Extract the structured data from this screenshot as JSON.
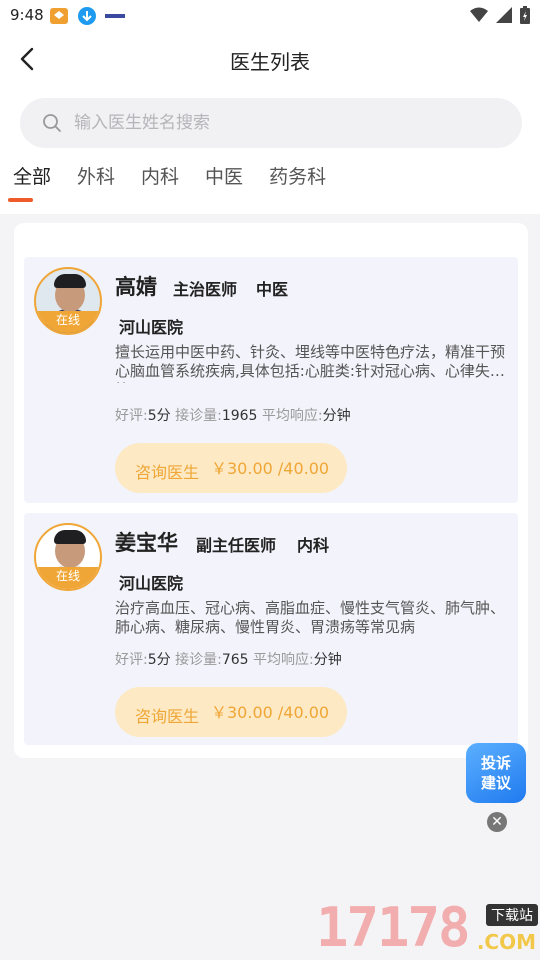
{
  "status_bar": {
    "time": "9:48"
  },
  "header": {
    "title": "医生列表"
  },
  "search": {
    "placeholder": "输入医生姓名搜索"
  },
  "tabs": [
    {
      "label": "全部",
      "active": true
    },
    {
      "label": "外科",
      "active": false
    },
    {
      "label": "内科",
      "active": false
    },
    {
      "label": "中医",
      "active": false
    },
    {
      "label": "药务科",
      "active": false
    }
  ],
  "doctors": [
    {
      "name": "高婧",
      "title": "主治医师",
      "dept": "中医",
      "hospital": "河山医院",
      "badge": "在线",
      "desc": "擅长运用中医中药、针灸、埋线等中医特色疗法，精准干预心脑血管系统疾病,具体包括:心脏类:针对冠心病、心律失常等",
      "rating_label": "好评:",
      "rating": "5分",
      "consult_label": "接诊量:",
      "consult_count": "1965",
      "resp_label": "平均响应:",
      "resp_unit": "分钟",
      "button_label": "咨询医生",
      "price": "￥30.00 /40.00"
    },
    {
      "name": "姜宝华",
      "title": "副主任医师",
      "dept": "内科",
      "hospital": "河山医院",
      "badge": "在线",
      "desc": "治疗高血压、冠心病、高脂血症、慢性支气管炎、肺气肿、肺心病、糖尿病、慢性胃炎、胃溃疡等常见病",
      "rating_label": "好评:",
      "rating": "5分",
      "consult_label": "接诊量:",
      "consult_count": "765",
      "resp_label": "平均响应:",
      "resp_unit": "分钟",
      "button_label": "咨询医生",
      "price": "￥30.00 /40.00"
    }
  ],
  "fab": {
    "line1": "投诉",
    "line2": "建议"
  },
  "watermark": {
    "number": "17178",
    "tag": "下载站",
    "domain": ".COM"
  },
  "colors": {
    "accent": "#ef5a2a",
    "orange": "#f0a636",
    "button_bg": "#fde9c4",
    "fab_blue": "#2f86f5"
  }
}
